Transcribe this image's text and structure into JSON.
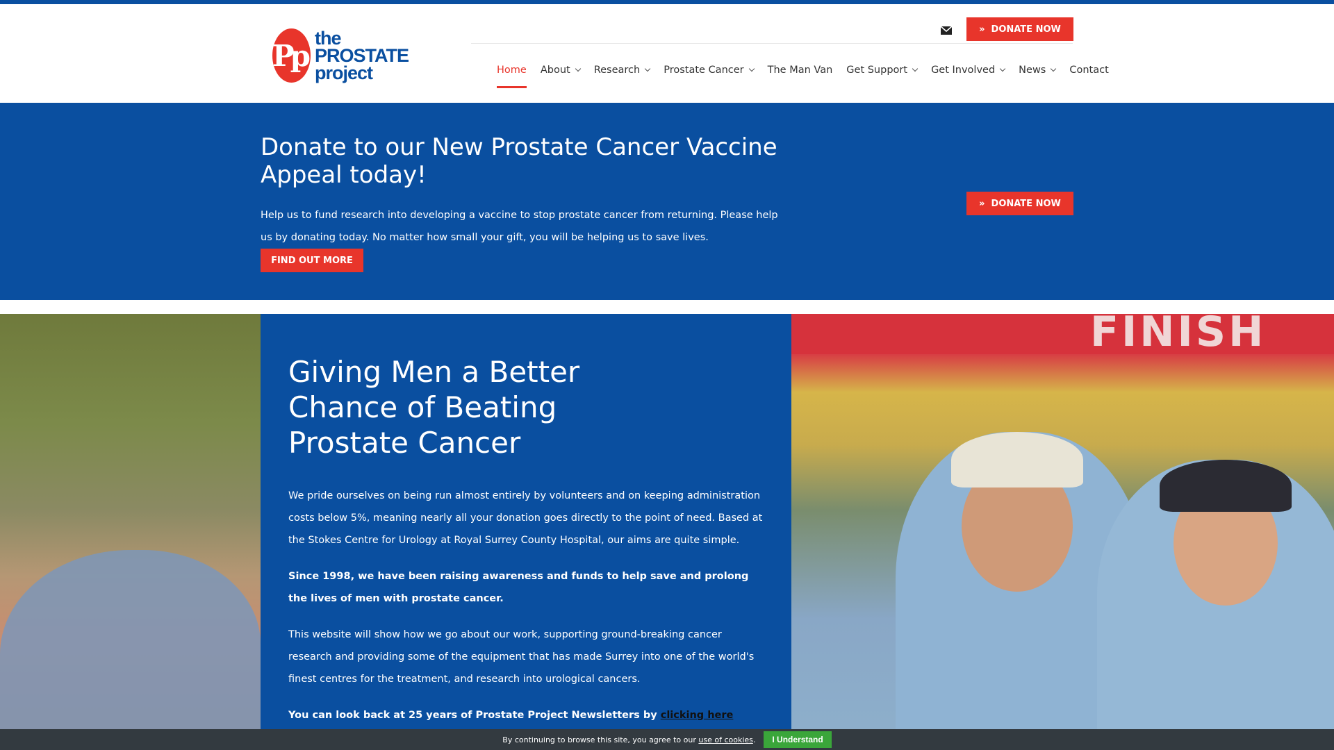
{
  "colors": {
    "brand_blue": "#0a4fa0",
    "accent_red": "#e8352b",
    "cookie_green": "#3aa63a",
    "cookie_bg": "#333a40"
  },
  "logo": {
    "initials": "Pp",
    "line1": "the",
    "line2": "PROSTATE",
    "line3": "project"
  },
  "header": {
    "mail_icon": "envelope-icon",
    "donate_label": "DONATE NOW"
  },
  "nav": {
    "items": [
      {
        "label": "Home",
        "active": true,
        "dropdown": false
      },
      {
        "label": "About",
        "dropdown": true
      },
      {
        "label": "Research",
        "dropdown": true
      },
      {
        "label": "Prostate Cancer",
        "dropdown": true
      },
      {
        "label": "The Man Van",
        "dropdown": false
      },
      {
        "label": "Get Support",
        "dropdown": true
      },
      {
        "label": "Get Involved",
        "dropdown": true
      },
      {
        "label": "News",
        "dropdown": true
      },
      {
        "label": "Contact",
        "dropdown": false
      }
    ]
  },
  "banner": {
    "title": "Donate to our New Prostate Cancer Vaccine Appeal today!",
    "text": "Help us to fund research into developing a vaccine to stop prostate cancer from returning.  Please help us by donating today. No matter how small your gift,  you will be helping us to save lives.",
    "cta_label": "FIND OUT MORE",
    "donate_label": "DONATE NOW"
  },
  "hero": {
    "title": "Giving Men a Better Chance of Beating Prostate Cancer",
    "p1": "We pride ourselves on being run almost entirely by volunteers and on keeping administration costs below 5%, meaning nearly all your donation goes directly to the point of need. Based at the Stokes Centre for Urology at Royal Surrey County Hospital, our aims are quite simple.",
    "p2": "Since 1998, we have been raising awareness and funds to help save and prolong the lives of men with prostate cancer.",
    "p3": "This website will show how we go about our work, supporting ground-breaking cancer research and providing some of the equipment that has made Surrey into one of the world's finest centres for the treatment, and research into urological cancers.",
    "p4_prefix": "You can look back at 25 years of Prostate Project Newsletters by ",
    "p4_link": "clicking here",
    "photo_text": "FINISH"
  },
  "cookie": {
    "text_prefix": "By continuing to browse this site, you agree to our ",
    "link": "use of cookies",
    "text_suffix": ".",
    "button": "I Understand"
  }
}
